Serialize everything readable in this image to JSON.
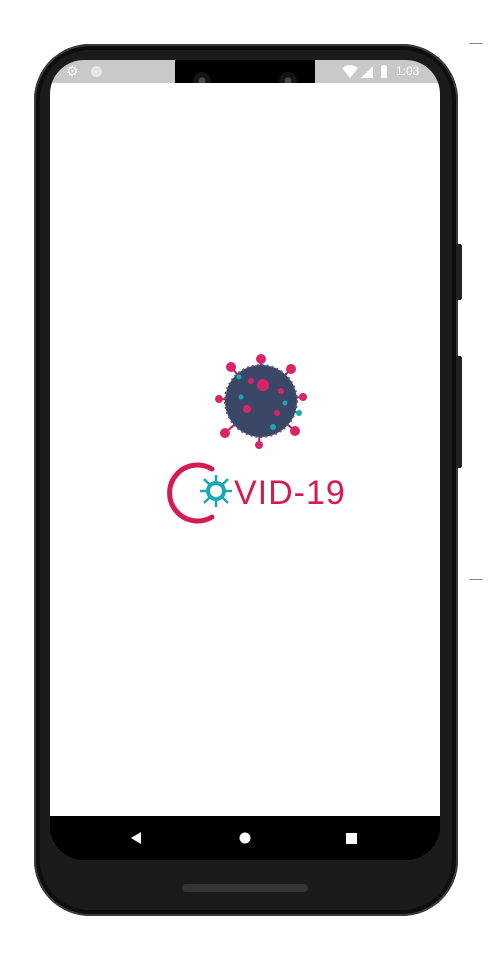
{
  "status_bar": {
    "time": "1:03"
  },
  "splash": {
    "logo_text": "VID-19"
  },
  "navigation": {
    "back": "back-icon",
    "home": "home-icon",
    "recents": "recents-icon"
  },
  "colors": {
    "brand": "#d41c52",
    "accent": "#19a9b5",
    "virus_body": "#3b4766"
  }
}
